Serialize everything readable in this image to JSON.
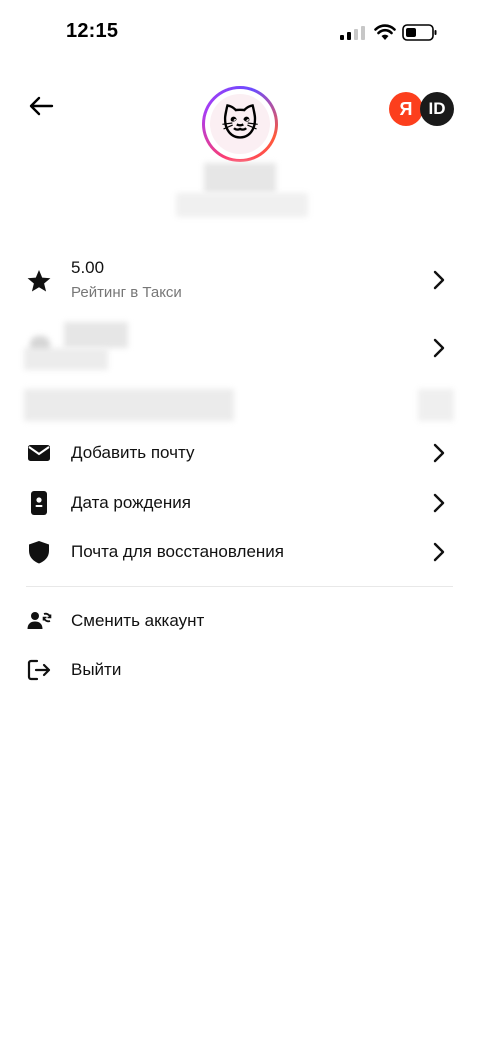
{
  "status_bar": {
    "time": "12:15"
  },
  "header": {
    "yandex_id_letter": "Я",
    "yandex_id_text": "ID",
    "avatar_emoji": "🐱"
  },
  "rating": {
    "value": "5.00",
    "caption": "Рейтинг в Такси"
  },
  "menu": {
    "add_email": "Добавить почту",
    "birth_date": "Дата рождения",
    "recovery_email": "Почта для восстановления",
    "switch_account": "Сменить аккаунт",
    "logout": "Выйти"
  },
  "colors": {
    "yandex_red": "#fc3f1d",
    "id_dark": "#1a1a1a"
  }
}
